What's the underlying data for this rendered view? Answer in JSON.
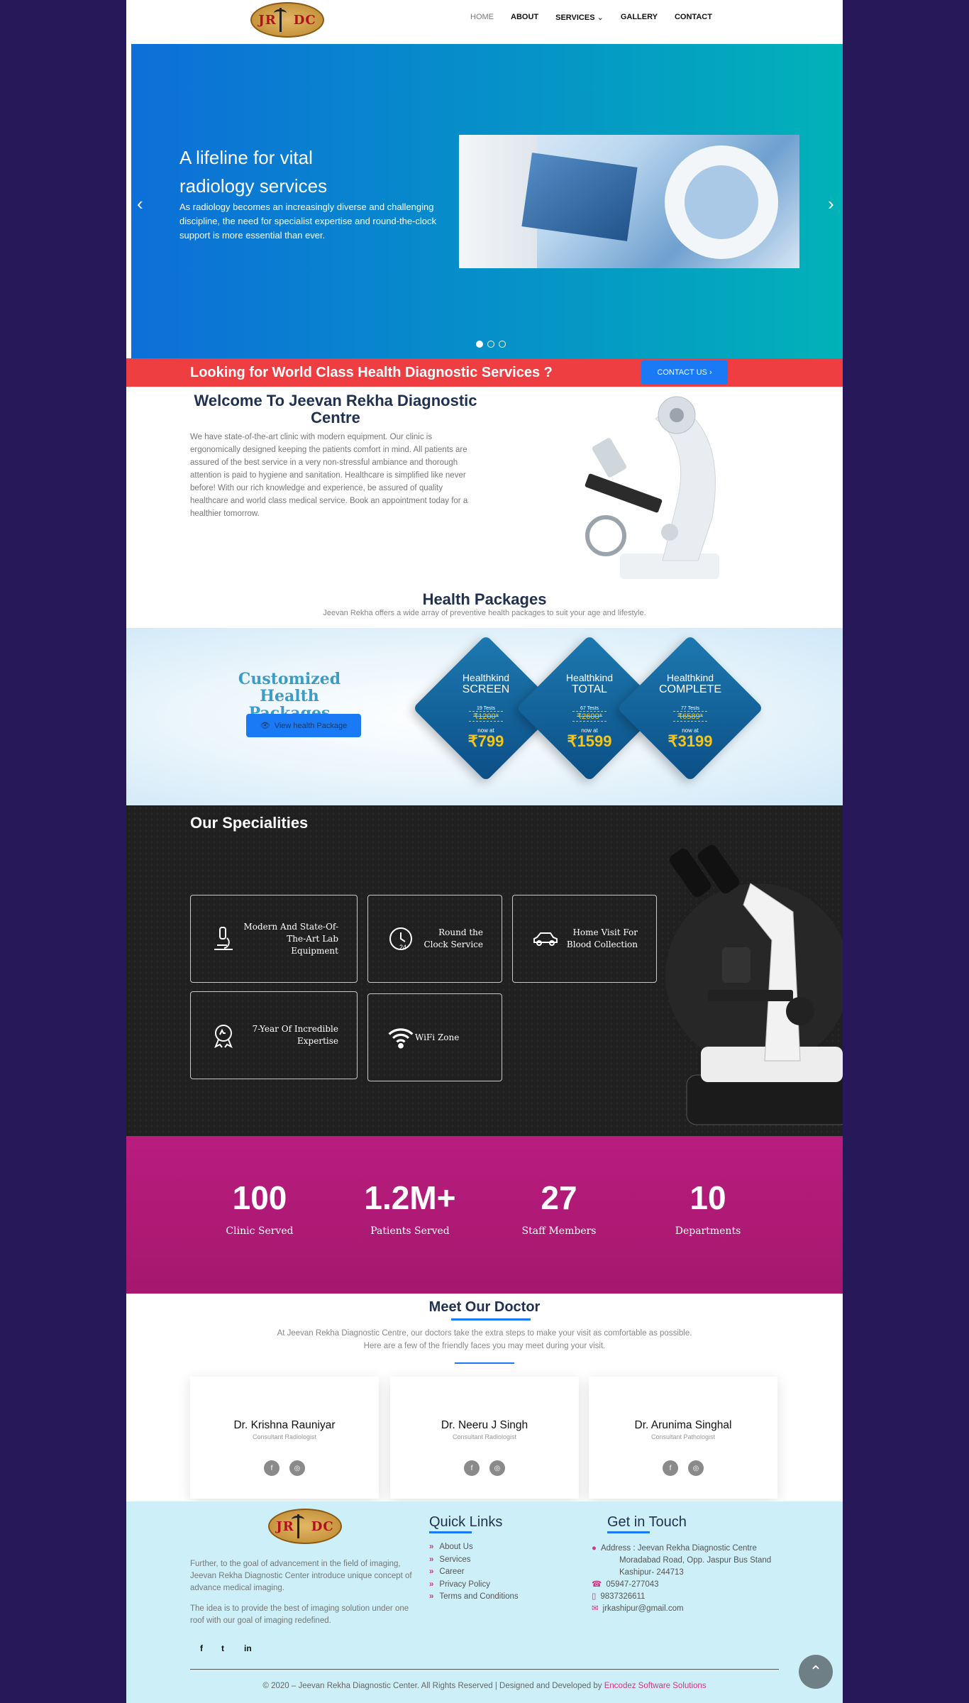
{
  "nav": {
    "logo_left": "JR",
    "logo_right": "DC",
    "items": [
      "HOME",
      "ABOUT",
      "SERVICES",
      "GALLERY",
      "CONTACT"
    ]
  },
  "hero": {
    "title": "A lifeline for vital radiology services",
    "text": "As radiology becomes an increasingly diverse and challenging discipline, the need for specialist expertise and round-the-clock support is more essential than ever.",
    "prev_icon": "chevron-left-icon",
    "next_icon": "chevron-right-icon"
  },
  "cta": {
    "text": "Looking for World Class Health Diagnostic Services ?",
    "button": "CONTACT US"
  },
  "welcome": {
    "title": "Welcome To Jeevan Rekha Diagnostic Centre",
    "text": "We have state-of-the-art clinic with modern equipment. Our clinic is ergonomically designed keeping the patients comfort in mind. All patients are assured of the best service in a very non-stressful ambiance and thorough attention is paid to hygiene and sanitation. Healthcare is simplified like never before! With our rich knowledge and experience, be assured of quality healthcare and world class medical service. Book an appointment today for a healthier tomorrow."
  },
  "packages": {
    "title": "Health Packages",
    "subtitle": "Jeevan Rekha offers a wide array of preventive health packages to suit your age and lifestyle.",
    "banner_title": "Customized Health Packages",
    "button": "View health Package",
    "cards": [
      {
        "kind": "Healthkind",
        "name": "SCREEN",
        "tests": "19 Tests",
        "old": "₹1200*",
        "now": "now at",
        "price": "₹799"
      },
      {
        "kind": "Healthkind",
        "name": "TOTAL",
        "tests": "67 Tests",
        "old": "₹2600*",
        "now": "now at",
        "price": "₹1599"
      },
      {
        "kind": "Healthkind",
        "name": "COMPLETE",
        "tests": "77 Tests",
        "old": "₹6589*",
        "now": "now at",
        "price": "₹3199"
      }
    ]
  },
  "specialities": {
    "title": "Our Specialities",
    "items": [
      {
        "label": "Modern And State-Of-The-Art Lab Equipment",
        "icon": "microscope-icon"
      },
      {
        "label": "Round the Clock Service",
        "icon": "clock-24-icon"
      },
      {
        "label": "Home Visit For Blood Collection",
        "icon": "car-icon"
      },
      {
        "label": "7-Year Of Incredible Expertise",
        "icon": "award-badge-icon"
      },
      {
        "label": "WiFi Zone",
        "icon": "wifi-icon"
      }
    ]
  },
  "counters": [
    {
      "value": "100",
      "label": "Clinic Served"
    },
    {
      "value": "1.2M+",
      "label": "Patients Served"
    },
    {
      "value": "27",
      "label": "Staff Members"
    },
    {
      "value": "10",
      "label": "Departments"
    }
  ],
  "doctors": {
    "title": "Meet Our Doctor",
    "subtitle1": "At Jeevan Rekha Diagnostic Centre, our doctors take the extra steps to make your visit as comfortable as possible.",
    "subtitle2": "Here are a few of the friendly faces you may meet during your visit.",
    "list": [
      {
        "name": "Dr. Krishna Rauniyar",
        "role": "Consultant Radiologist"
      },
      {
        "name": "Dr. Neeru J Singh",
        "role": "Consultant Radiologist"
      },
      {
        "name": "Dr. Arunima Singhal",
        "role": "Consultant Pathologist"
      }
    ]
  },
  "footer": {
    "about1": "Further, to the goal of advancement in the field of imaging, Jeevan Rekha Diagnostic Center introduce unique concept of advance medical imaging.",
    "about2": "The idea is to provide the best of imaging solution under one roof with our goal of imaging redefined.",
    "quick_title": "Quick Links",
    "links": [
      "About Us",
      "Services",
      "Career",
      "Privacy Policy",
      "Terms and Conditions"
    ],
    "touch_title": "Get in Touch",
    "address1": "Address : Jeevan Rekha Diagnostic Centre",
    "address2": "Moradabad Road, Opp. Jaspur Bus Stand",
    "address3": "Kashipur- 244713",
    "phone": "05947-277043",
    "mobile": "9837326611",
    "email": "jrkashipur@gmail.com",
    "copyright": "© 2020 – Jeevan Rekha Diagnostic Center. All Rights Reserved | Designed and Developed by ",
    "developer": "Encodez Software Solutions"
  }
}
